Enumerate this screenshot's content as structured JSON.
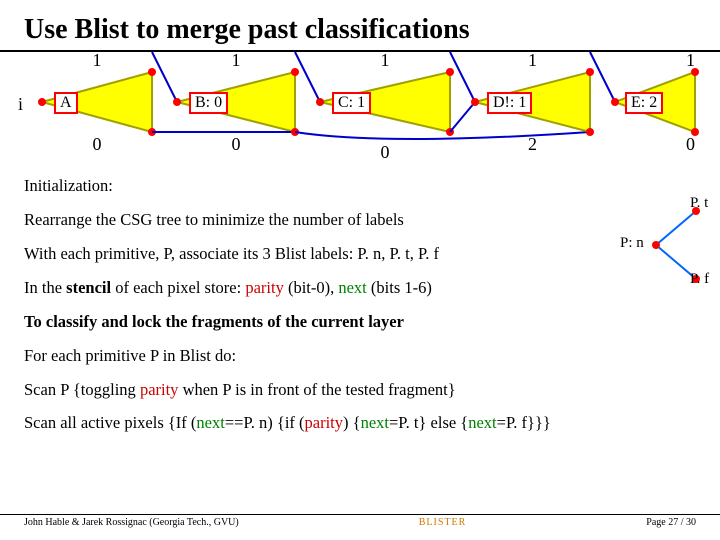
{
  "title": "Use Blist to merge past classifications",
  "diagram": {
    "i_label": "i",
    "nodes": [
      {
        "top": "1",
        "box": "A",
        "bottom": "0"
      },
      {
        "top": "1",
        "box": "B: 0",
        "bottom": "0"
      },
      {
        "top": "1",
        "box": "C: 1",
        "bottom": "0"
      },
      {
        "top": "1",
        "box": "D!: 1",
        "bottom": "2"
      },
      {
        "top": "1",
        "box": "E: 2",
        "bottom": "0"
      }
    ]
  },
  "pt_tree": {
    "root": "P: n",
    "left_leaf": "P. t",
    "right_leaf": "P. f"
  },
  "text": {
    "init_heading": "Initialization:",
    "init_line1": "Rearrange the CSG tree to minimize the number of labels",
    "init_line2": "With each primitive, P, associate its 3 Blist labels: P. n, P. t, P. f",
    "stencil_prefix": "In the ",
    "stencil_bold": "stencil",
    "stencil_mid": " of each pixel store: ",
    "parity": "parity",
    "stencil_after_parity": " (bit-0), ",
    "next": "next",
    "stencil_after_next": " (bits 1-6)",
    "classify_bold": "To classify and lock the fragments of the current layer",
    "foreach": "For each primitive P in Blist do:",
    "scan1_a": "Scan P {toggling ",
    "scan1_b": " when P is in front of the tested fragment}",
    "scan2_a": "Scan all active pixels {If (",
    "scan2_b": "==P. n) {if (",
    "scan2_c": ") {",
    "scan2_d": "=P. t} else {",
    "scan2_e": "=P. f}}}"
  },
  "footer": {
    "left": "John Hable & Jarek Rossignac (Georgia Tech., GVU)",
    "center": "BLISTER",
    "right": "Page 27 / 30"
  }
}
